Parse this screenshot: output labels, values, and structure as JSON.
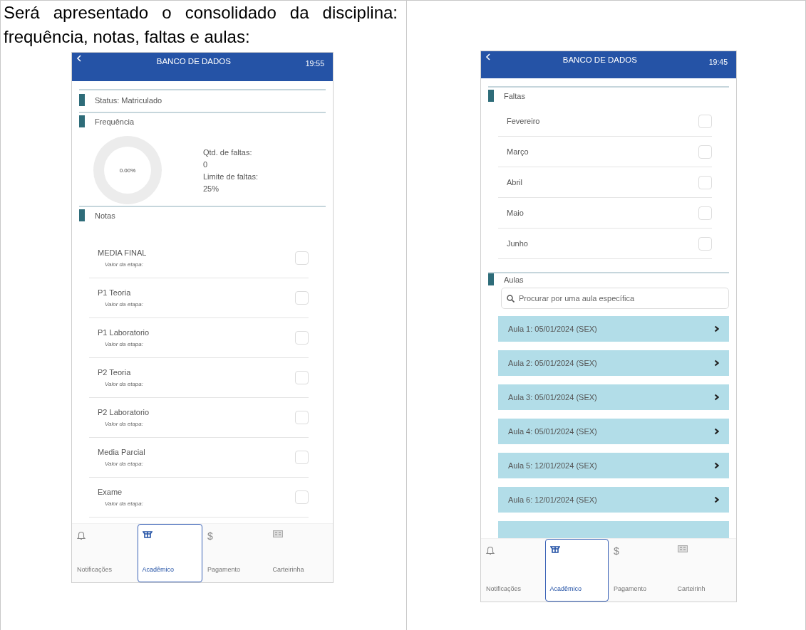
{
  "intro": "Será apresentado o consolidado da disciplina: frequência, notas, faltas e aulas:",
  "screens": [
    {
      "title": "BANCO DE DADOS",
      "time": "19:55",
      "sections": [
        {
          "kind": "status",
          "label": "Status: Matriculado"
        },
        {
          "kind": "frequency",
          "label": "Frequência",
          "donut_label": "0.00%",
          "stats": [
            "Qtd. de faltas:",
            "0",
            "Limite de faltas:",
            "25%"
          ]
        },
        {
          "kind": "checklist",
          "label": "Notas",
          "items": [
            {
              "name": "MEDIA FINAL",
              "sub": "Valor da etapa:",
              "checked": false
            },
            {
              "name": "P1 Teoria",
              "sub": "Valor da etapa:",
              "checked": false
            },
            {
              "name": "P1 Laboratorio",
              "sub": "Valor da etapa:",
              "checked": false
            },
            {
              "name": "P2 Teoria",
              "sub": "Valor da etapa:",
              "checked": false
            },
            {
              "name": "P2 Laboratorio",
              "sub": "Valor da etapa:",
              "checked": false
            },
            {
              "name": "Media Parcial",
              "sub": "Valor da etapa:",
              "checked": false
            },
            {
              "name": "Exame",
              "sub": "Valor da etapa:",
              "checked": false
            }
          ]
        }
      ],
      "nav": [
        {
          "label": "Notificações",
          "selected": false
        },
        {
          "label": "Acadêmico",
          "selected": true
        },
        {
          "label": "Pagamento",
          "glyph": "$",
          "selected": false
        },
        {
          "label": "Carteirinha",
          "selected": false
        }
      ]
    },
    {
      "title": "BANCO DE DADOS",
      "time": "19:45",
      "sections": [
        {
          "kind": "checklist",
          "label": "Faltas",
          "items": [
            {
              "name": "Fevereiro",
              "checked": false
            },
            {
              "name": "Março",
              "checked": false
            },
            {
              "name": "Abril",
              "checked": false
            },
            {
              "name": "Maio",
              "checked": false
            },
            {
              "name": "Junho",
              "checked": false
            }
          ]
        },
        {
          "kind": "lessons",
          "label": "Aulas",
          "placeholder": "Procurar por uma aula específica",
          "items": [
            "Aula 1: 05/01/2024 (SEX)",
            "Aula 2: 05/01/2024 (SEX)",
            "Aula 3: 05/01/2024 (SEX)",
            "Aula 4: 05/01/2024 (SEX)",
            "Aula 5: 12/01/2024 (SEX)",
            "Aula 6: 12/01/2024 (SEX)"
          ]
        }
      ],
      "nav": [
        {
          "label": "Notificações",
          "selected": false
        },
        {
          "label": "Acadêmico",
          "selected": true
        },
        {
          "label": "Pagamento",
          "glyph": "$",
          "selected": false
        },
        {
          "label": "Carteirinh",
          "selected": false
        }
      ]
    }
  ]
}
